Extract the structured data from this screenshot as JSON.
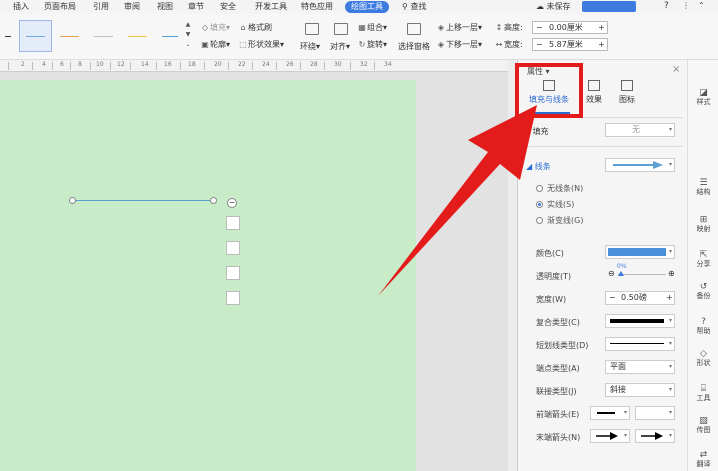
{
  "menu": {
    "tabs": [
      "插入",
      "页面布局",
      "引用",
      "审阅",
      "视图",
      "章节",
      "安全",
      "开发工具",
      "特色应用",
      "绘图工具"
    ],
    "active_tab": "绘图工具",
    "search": "查找",
    "unsaved": "未保存",
    "help": "?"
  },
  "ribbon": {
    "fill": "填充",
    "format_brush": "格式刷",
    "outline": "轮廓",
    "shape_effect": "形状效果",
    "wrap": "环绕",
    "align": "对齐",
    "group": "组合",
    "rotate": "旋转",
    "select_pane": "选择窗格",
    "bring_forward": "上移一层",
    "send_backward": "下移一层",
    "height_label": "高度:",
    "height_value": "0.00厘米",
    "width_label": "宽度:",
    "width_value": "5.87厘米"
  },
  "ruler": {
    "marks": [
      "2",
      "4",
      "6",
      "8",
      "10",
      "12",
      "14",
      "16",
      "18",
      "20",
      "22",
      "24",
      "26",
      "28",
      "30",
      "32",
      "34"
    ]
  },
  "properties": {
    "title": "属性",
    "tabs": {
      "fill_line": "填充与线条",
      "effects": "效果",
      "icon": "图标"
    },
    "fill": {
      "label": "填充",
      "value": "无"
    },
    "line": {
      "label": "线条"
    },
    "radios": {
      "no_line": "无线条(N)",
      "solid": "实线(S)",
      "gradient": "渐变线(G)"
    },
    "color": {
      "label": "颜色(C)",
      "value": "#4a90d9"
    },
    "transparency": {
      "label": "透明度(T)",
      "value": "0%"
    },
    "width": {
      "label": "宽度(W)",
      "value": "0.50磅"
    },
    "compound": {
      "label": "复合类型(C)"
    },
    "dash": {
      "label": "短划线类型(D)"
    },
    "cap": {
      "label": "端点类型(A)",
      "value": "平面"
    },
    "join": {
      "label": "联接类型(J)",
      "value": "斜接"
    },
    "begin_arrow": {
      "label": "前端箭头(E)"
    },
    "end_arrow": {
      "label": "末端箭头(N)"
    }
  },
  "sidebar": {
    "items": [
      "样式",
      "结构",
      "映射",
      "分享",
      "备份",
      "帮助",
      "形状",
      "工具",
      "传图",
      "翻译"
    ]
  },
  "colors": {
    "accent": "#3d7be0",
    "page": "#c7ecc7",
    "callout": "#e41b1b"
  }
}
